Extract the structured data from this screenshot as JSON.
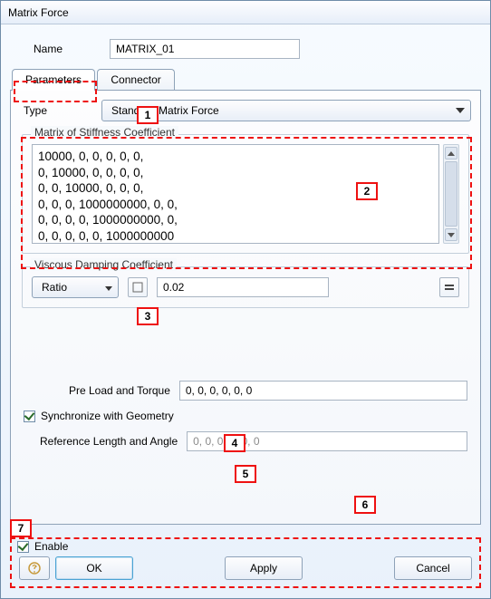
{
  "window": {
    "title": "Matrix Force"
  },
  "name": {
    "label": "Name",
    "value": "MATRIX_01"
  },
  "tabs": {
    "parameters": "Parameters",
    "connector": "Connector"
  },
  "type": {
    "label": "Type",
    "selected": "Standard Matrix Force"
  },
  "stiffness": {
    "title": "Matrix of Stiffness Coefficient",
    "text": "10000, 0, 0, 0, 0, 0,\n0, 10000, 0, 0, 0, 0,\n0, 0, 10000, 0, 0, 0,\n0, 0, 0, 1000000000, 0, 0,\n0, 0, 0, 0, 1000000000, 0,\n0, 0, 0, 0, 0, 1000000000"
  },
  "damping": {
    "title": "Viscous Damping Coefficient",
    "mode": "Ratio",
    "value": "0.02"
  },
  "preload": {
    "label": "Pre Load and Torque",
    "value": "0, 0, 0, 0, 0, 0"
  },
  "sync": {
    "label": "Synchronize with Geometry",
    "checked": true
  },
  "refla": {
    "label": "Reference Length and Angle",
    "value": "0, 0, 0, 0, 0, 0"
  },
  "enable": {
    "label": "Enable",
    "checked": true
  },
  "buttons": {
    "ok": "OK",
    "apply": "Apply",
    "cancel": "Cancel"
  },
  "annotations": {
    "a1": "1",
    "a2": "2",
    "a3": "3",
    "a4": "4",
    "a5": "5",
    "a6": "6",
    "a7": "7"
  }
}
